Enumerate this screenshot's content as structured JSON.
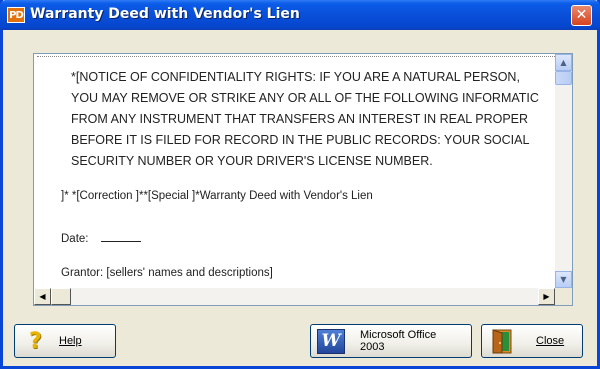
{
  "window": {
    "title": "Warranty Deed with Vendor's Lien",
    "logo_text": "PD",
    "close_glyph": "✕"
  },
  "document": {
    "notice_lines": [
      "*[NOTICE OF CONFIDENTIALITY RIGHTS:  IF YOU ARE A NATURAL PERSON,",
      "YOU MAY REMOVE OR STRIKE ANY OR ALL OF THE FOLLOWING INFORMATIC",
      "FROM ANY INSTRUMENT THAT TRANSFERS AN INTEREST IN REAL PROPER",
      "BEFORE IT IS FILED FOR RECORD IN THE PUBLIC RECORDS:  YOUR SOCIAL",
      "SECURITY NUMBER OR YOUR DRIVER'S LICENSE NUMBER."
    ],
    "deed_title_line": "]*   *[Correction ]**[Special ]*Warranty Deed with Vendor's Lien",
    "date_label": "Date:",
    "grantor_line": "Grantor:  [sellers' names and descriptions]"
  },
  "scrollbars": {
    "up_glyph": "▲",
    "down_glyph": "▼",
    "left_glyph": "◀",
    "right_glyph": "▶"
  },
  "buttons": {
    "help": {
      "label": "Help",
      "icon": "help-question-icon",
      "glyph": "?"
    },
    "office": {
      "label_line1": "Microsoft Office",
      "label_line2": "2003",
      "icon": "word-icon",
      "glyph": "W"
    },
    "close": {
      "label": "Close",
      "icon": "exit-door-icon"
    }
  }
}
